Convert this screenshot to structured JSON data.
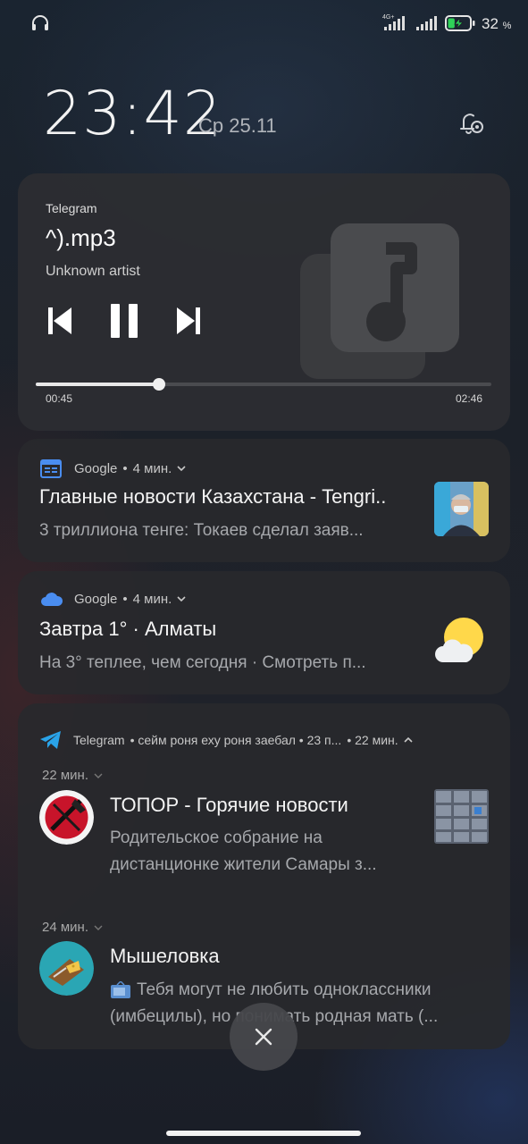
{
  "status_bar": {
    "network_label": "4G+",
    "battery_percent": "32",
    "battery_unit": "%",
    "battery_level": 0.32,
    "charging": true
  },
  "lockscreen": {
    "time": "23:42",
    "date": "Ср 25.11"
  },
  "media": {
    "app": "Telegram",
    "title": "^).mp3",
    "artist": "Unknown artist",
    "current_time": "00:45",
    "duration": "02:46",
    "progress": 0.271
  },
  "notifications": [
    {
      "app": "Google",
      "dot": "•",
      "time": "4 мин.",
      "title": "Главные новости Казахстана - Tengri..",
      "text": "3 триллиона тенге: Токаев сделал заяв..."
    },
    {
      "app": "Google",
      "dot": "•",
      "time": "4 мин.",
      "title": "Завтра 1° · Алматы",
      "text": "На 3° теплее, чем сегодня · Смотреть п..."
    }
  ],
  "telegram_group": {
    "app": "Telegram",
    "summary": "• сейм роня еху роня заебал • 23 п...",
    "time": "• 22 мин.",
    "messages": [
      {
        "time": "22 мин.",
        "sender": "ТОПОР - Горячие новости",
        "line1": "Родительское собрание на",
        "line2": "дистанционке жители Самары з..."
      },
      {
        "time": "24 мин.",
        "sender": "Мышеловка",
        "line1": "Тебя могут не любить одноклассники",
        "line2": "(имбецилы), но понимать родная мать (..."
      }
    ]
  },
  "colors": {
    "accent_blue": "#4a8df0",
    "telegram_blue": "#2aa3e8",
    "sun_yellow": "#ffd84a"
  }
}
